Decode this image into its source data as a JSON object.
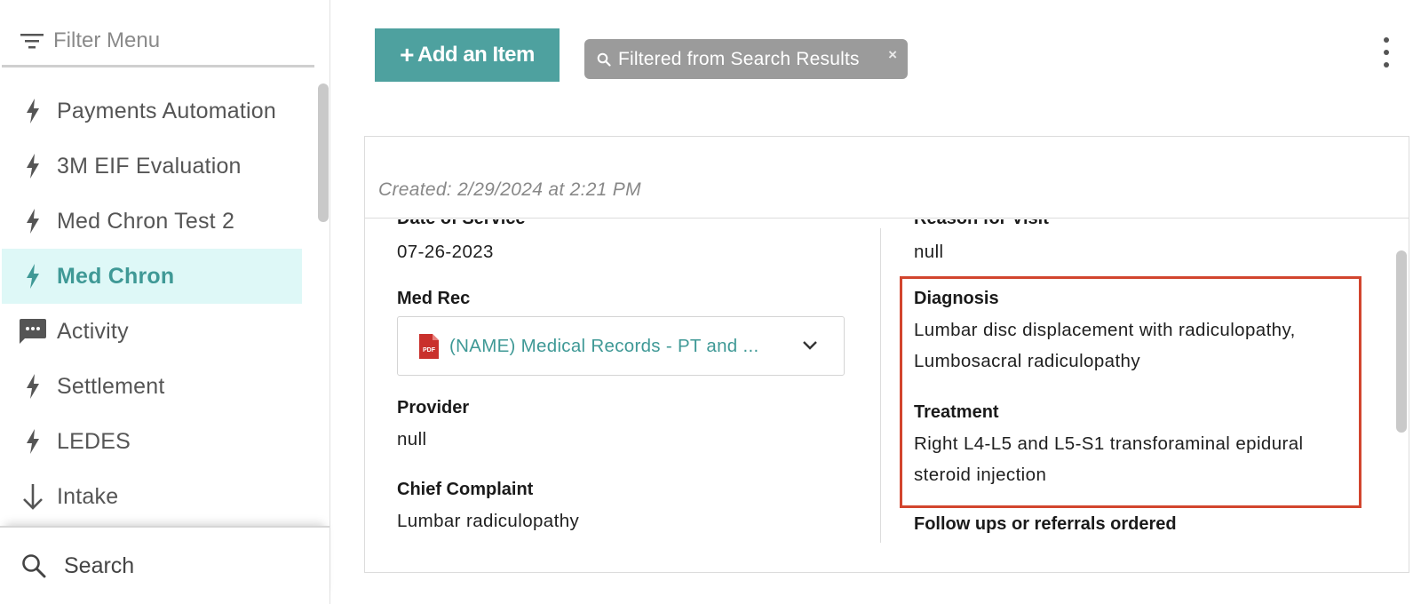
{
  "sidebar": {
    "filter_placeholder": "Filter Menu",
    "items": [
      {
        "label": "Payments Automation",
        "icon": "lightning-icon"
      },
      {
        "label": "3M EIF Evaluation",
        "icon": "lightning-icon"
      },
      {
        "label": "Med Chron Test 2",
        "icon": "lightning-icon"
      },
      {
        "label": "Med Chron",
        "icon": "lightning-icon",
        "active": true
      },
      {
        "label": "Activity",
        "icon": "chat-icon"
      },
      {
        "label": "Settlement",
        "icon": "lightning-icon"
      },
      {
        "label": "LEDES",
        "icon": "lightning-icon"
      },
      {
        "label": "Intake",
        "icon": "arrow-down-icon"
      }
    ],
    "search_label": "Search"
  },
  "toolbar": {
    "add_label": "Add an Item",
    "filter_chip_label": "Filtered from Search Results",
    "filter_chip_close": "×"
  },
  "card": {
    "created": "Created: 2/29/2024 at 2:21 PM",
    "left": {
      "date_of_service_label": "Date of Service",
      "date_of_service_value": "07-26-2023",
      "med_rec_label": "Med Rec",
      "med_rec_value": "(NAME) Medical Records - PT and ...",
      "provider_label": "Provider",
      "provider_value": "null",
      "chief_complaint_label": "Chief Complaint",
      "chief_complaint_value": "Lumbar radiculopathy"
    },
    "right": {
      "reason_label": "Reason for Visit",
      "reason_value": "null",
      "diagnosis_label": "Diagnosis",
      "diagnosis_line1": "Lumbar disc displacement with radiculopathy,",
      "diagnosis_line2": "Lumbosacral radiculopathy",
      "treatment_label": "Treatment",
      "treatment_line1": "Right L4-L5 and L5-S1 transforaminal epidural",
      "treatment_line2": "steroid injection",
      "followups_label": "Follow ups or referrals ordered"
    }
  },
  "colors": {
    "accent": "#4ea19f",
    "active_bg": "#def8f7",
    "highlight": "#d2452e",
    "chip_bg": "#9b9b9b"
  }
}
